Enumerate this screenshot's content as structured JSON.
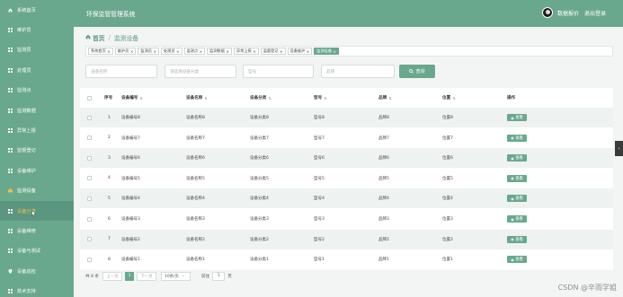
{
  "app": {
    "title": "环保监管管理系统"
  },
  "header": {
    "user": "数据报价",
    "logout": "退出登录"
  },
  "sidebar": {
    "items": [
      {
        "label": "系统首页",
        "icon": "home-icon"
      },
      {
        "label": "维护员",
        "icon": "grid-icon"
      },
      {
        "label": "监测员",
        "icon": "grid-icon"
      },
      {
        "label": "处理员",
        "icon": "grid-icon"
      },
      {
        "label": "监测点",
        "icon": "grid-icon"
      },
      {
        "label": "监测数据",
        "icon": "grid-icon"
      },
      {
        "label": "异常上报",
        "icon": "grid-icon"
      },
      {
        "label": "监督登记",
        "icon": "grid-icon"
      },
      {
        "label": "设备维护",
        "icon": "grid-icon"
      },
      {
        "label": "监测设备",
        "icon": "briefcase-icon"
      },
      {
        "label": "设备分类",
        "icon": "grid-icon"
      },
      {
        "label": "设备维修",
        "icon": "grid-icon"
      },
      {
        "label": "设备与测试",
        "icon": "grid-icon"
      },
      {
        "label": "设备巡检",
        "icon": "pin-icon"
      },
      {
        "label": "技术支持",
        "icon": "grid-icon"
      }
    ],
    "active_index": 10
  },
  "breadcrumb": {
    "home": "首页",
    "current": "监测设备"
  },
  "tags": [
    {
      "label": "系统首页",
      "active": false
    },
    {
      "label": "维护员",
      "active": false
    },
    {
      "label": "监测员",
      "active": false
    },
    {
      "label": "处理员",
      "active": false
    },
    {
      "label": "监测点",
      "active": false
    },
    {
      "label": "监测数据",
      "active": false
    },
    {
      "label": "异常上报",
      "active": false
    },
    {
      "label": "监督登记",
      "active": false
    },
    {
      "label": "设备维护",
      "active": false
    },
    {
      "label": "监测设备",
      "active": true
    }
  ],
  "search": {
    "name_placeholder": "设备名称",
    "category_placeholder": "请选择设备分类",
    "model_placeholder": "型号",
    "brand_placeholder": "品牌",
    "button_label": "查询"
  },
  "table": {
    "headers": [
      "序号",
      "设备编号",
      "设备名称",
      "设备分类",
      "型号",
      "品牌",
      "位置",
      "操作"
    ],
    "view_label": "查看",
    "rows": [
      [
        "1",
        "设备编号8",
        "设备名称8",
        "设备分类8",
        "型号8",
        "品牌8",
        "位置8"
      ],
      [
        "2",
        "设备编号7",
        "设备名称7",
        "设备分类7",
        "型号7",
        "品牌7",
        "位置7"
      ],
      [
        "3",
        "设备编号6",
        "设备名称6",
        "设备分类6",
        "型号6",
        "品牌6",
        "位置6"
      ],
      [
        "4",
        "设备编号5",
        "设备名称5",
        "设备分类5",
        "型号5",
        "品牌5",
        "位置5"
      ],
      [
        "5",
        "设备编号4",
        "设备名称4",
        "设备分类4",
        "型号4",
        "品牌4",
        "位置4"
      ],
      [
        "6",
        "设备编号3",
        "设备名称3",
        "设备分类3",
        "型号3",
        "品牌3",
        "位置3"
      ],
      [
        "7",
        "设备编号2",
        "设备名称2",
        "设备分类2",
        "型号2",
        "品牌2",
        "位置2"
      ],
      [
        "8",
        "设备编号1",
        "设备名称1",
        "设备分类1",
        "型号1",
        "品牌1",
        "位置1"
      ]
    ]
  },
  "pagination": {
    "total": "共 8 条",
    "prev": "上一页",
    "page": "1",
    "next": "下一页",
    "page_size": "10条/页",
    "goto": "前往",
    "goto_value": "1",
    "page_suffix": "页"
  },
  "side_tab": "‹",
  "watermark": "CSDN @辛雨学姐",
  "colors": {
    "primary": "#6aa88e",
    "active_text": "#f0c040"
  }
}
